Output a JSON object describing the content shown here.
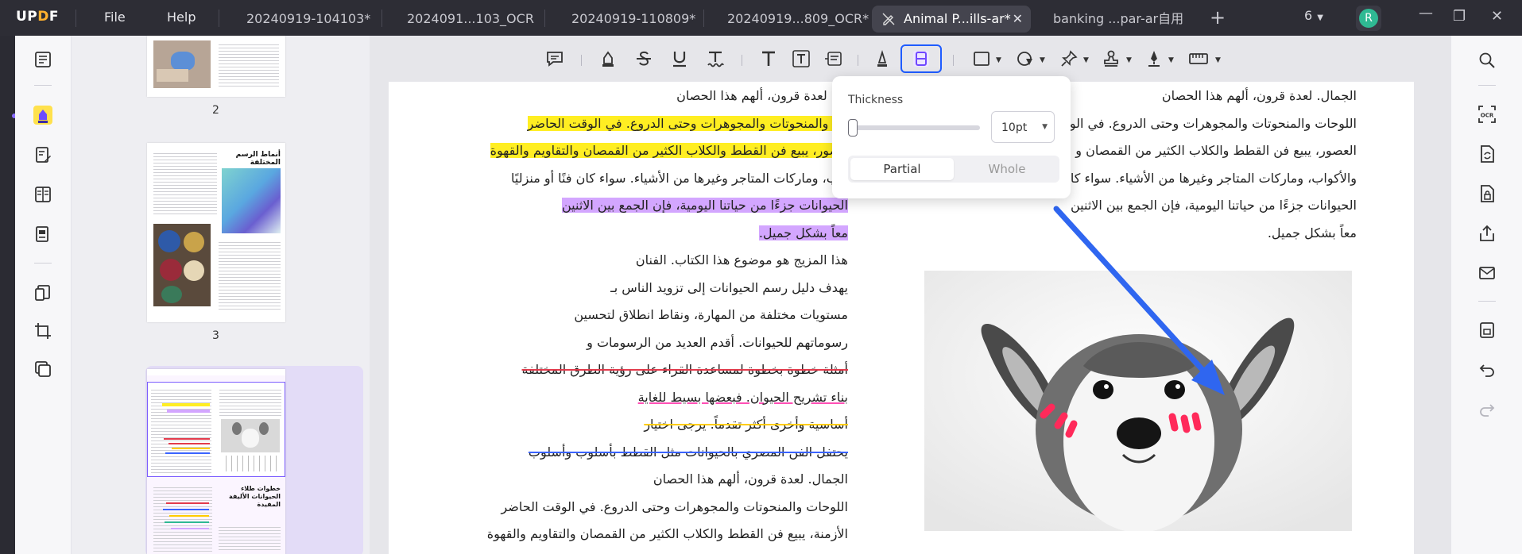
{
  "app": {
    "logo_up": "UP",
    "logo_d": "D",
    "logo_f": "F",
    "menu": [
      "File",
      "Help"
    ]
  },
  "tabs": [
    {
      "label": "20240919-104103*"
    },
    {
      "label": "2024091...103_OCR"
    },
    {
      "label": "20240919-110809*"
    },
    {
      "label": "20240919...809_OCR*"
    },
    {
      "label": "Animal P...ills-ar*",
      "active": true
    },
    {
      "label": "banking ...par-ar自用"
    }
  ],
  "tab_close": "✕",
  "new_tab": "+",
  "window_count": "6",
  "avatar_initial": "R",
  "window_controls": {
    "minimize": "—",
    "restore": "❐",
    "close": "✕"
  },
  "thumbnails": [
    {
      "page": "2"
    },
    {
      "page": "3",
      "heading": "أنماط الرسم المختلفة"
    },
    {
      "page": "4",
      "heading": "خطوات طلاء الحيوانات الأليفة المفيدة"
    }
  ],
  "popover": {
    "title": "Thickness",
    "size_value": "10pt",
    "slider_percent": 0,
    "segments": [
      "Partial",
      "Whole"
    ],
    "selected_segment": "Partial"
  },
  "doc": {
    "left_lines": [
      {
        "text": "ال. لعدة قرون، ألهم هذا الحصان",
        "style": ""
      },
      {
        "text": "ات والمنحوتات والمجوهرات وحتى الدروع. في الوقت الحاضر",
        "style": "hl-yellow"
      },
      {
        "text": "عصور، يبيع فن القطط والكلاب الكثير من القمصان والتقاويم والقهوة",
        "style": "hl-yellow"
      },
      {
        "text": "واب، وماركات المتاجر وغيرها من الأشياء. سواء كان فنًا أو منزليًا",
        "style": ""
      },
      {
        "text": "الحيوانات جزءًا من حياتنا اليومية، فإن الجمع بين الاثنين",
        "style": "hl-purple"
      },
      {
        "text": "معاً بشكل جميل.",
        "style": "hl-purple"
      },
      {
        "text": "هذا المزيج هو موضوع هذا الكتاب. الفنان",
        "style": ""
      },
      {
        "text": "يهدف دليل رسم الحيوانات إلى تزويد الناس بـ",
        "style": ""
      },
      {
        "text": "مستويات مختلفة من المهارة، ونقاط انطلاق لتحسين",
        "style": ""
      },
      {
        "text": "رسوماتهم للحيوانات. أقدم العديد من الرسومات و",
        "style": ""
      },
      {
        "text": "أمثلة خطوة بخطوة لمساعدة القراء على رؤية الطرق المختلفة",
        "style": "strike-red"
      },
      {
        "text": "بناء تشريح الحيوان. فبعضها بسيط للغاية",
        "style": "strike-red ul-pink"
      },
      {
        "text": "أساسية وأخرى أكثر تقدماً. يرجى اختيار",
        "style": "strike-yellow"
      },
      {
        "text": "يحتفل الفن المصري بالحيوانات مثل القطط بأسلوب وأسلوب",
        "style": "strike-blue"
      },
      {
        "text": "الجمال. لعدة قرون، ألهم هذا الحصان",
        "style": ""
      },
      {
        "text": "اللوحات والمنحوتات والمجوهرات وحتى الدروع. في الوقت الحاضر",
        "style": ""
      },
      {
        "text": "الأزمنة، يبيع فن القطط والكلاب الكثير من القمصان والتقاويم والقهوة",
        "style": ""
      }
    ],
    "right_lines": [
      {
        "text": "الجمال. لعدة قرون، ألهم هذا الحصان"
      },
      {
        "text": "اللوحات والمنحوتات والمجوهرات وحتى الدروع. في الو"
      },
      {
        "text": "العصور، يبيع فن القطط والكلاب الكثير من القمصان و"
      },
      {
        "text": "والأكواب، وماركات المتاجر وغيرها من الأشياء. سواء كا"
      },
      {
        "text": "الحيوانات جزءًا من حياتنا اليومية، فإن الجمع بين الاثنين"
      },
      {
        "text": "معاً بشكل جميل."
      }
    ]
  },
  "colors": {
    "accent": "#1f5cff",
    "highlight_yellow": "#ffee22",
    "highlight_purple": "#d3a6ff",
    "arrow_blue": "#2f66f0",
    "blush_red": "#ff2a5a"
  },
  "icons": {
    "toolbar": [
      "comment-icon",
      "highlighter-icon",
      "strikethrough-icon",
      "underline-icon",
      "squiggly-icon",
      "text-icon",
      "textbox-icon",
      "text-callout-icon",
      "pencil-icon",
      "eraser-icon",
      "rectangle-icon",
      "shape-icon",
      "pin-icon",
      "stamp-icon",
      "signature-icon",
      "measure-icon"
    ],
    "right_rail": [
      "search-icon",
      "ocr-icon",
      "convert-icon",
      "protect-icon",
      "share-icon",
      "email-icon",
      "save-icon",
      "undo-icon",
      "redo-icon"
    ]
  }
}
